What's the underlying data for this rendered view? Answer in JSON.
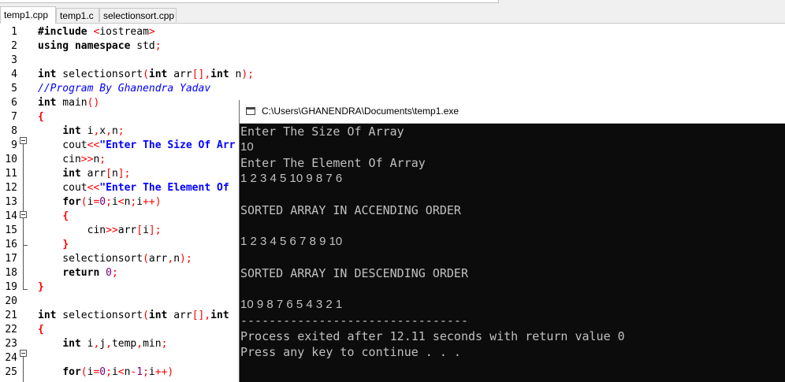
{
  "tabs": [
    "temp1.cpp",
    "temp1.c",
    "selectionsort.cpp"
  ],
  "editor": {
    "line_numbers": [
      "1",
      "2",
      "3",
      "4",
      "5",
      "6",
      "7",
      "8",
      "9",
      "10",
      "11",
      "12",
      "13",
      "14",
      "15",
      "16",
      "17",
      "18",
      "19",
      "20",
      "21",
      "22",
      "23",
      "24",
      "25"
    ],
    "lines": [
      "#include <iostream>",
      "using namespace std;",
      "",
      "int selectionsort(int arr[],int n);",
      "//Program By Ghanendra Yadav",
      "int main()",
      "{",
      "    int i,x,n;",
      "    cout<<\"Enter The Size Of Arr",
      "    cin>>n;",
      "    int arr[n];",
      "    cout<<\"Enter The Element Of ",
      "    for(i=0;i<n;i++)",
      "    {",
      "        cin>>arr[i];",
      "    }",
      "    selectionsort(arr,n);",
      "    return 0;",
      "}",
      "",
      "int selectionsort(int arr[],int ",
      "{",
      "    int i,j,temp,min;",
      "",
      "    for(i=0;i<n-1;i++)"
    ]
  },
  "console": {
    "title": "C:\\Users\\GHANENDRA\\Documents\\temp1.exe",
    "lines": [
      "Enter The Size Of Array",
      "10",
      "Enter The Element Of Array",
      "1 2 3 4 5 10 9 8 7 6",
      "",
      "SORTED ARRAY IN ACCENDING ORDER",
      "",
      "1 2 3 4 5 6 7 8 9 10",
      "",
      "SORTED ARRAY IN DESCENDING ORDER",
      "",
      "10 9 8 7 6 5 4 3 2 1",
      "--------------------------------",
      "Process exited after 12.11 seconds with return value 0",
      "Press any key to continue . . ."
    ]
  },
  "colors": {
    "console_bg": "#0c0c0c",
    "console_text": "#c0c0c0",
    "keyword": "#000000",
    "string": "#0000ff",
    "operator": "#ff0000",
    "number": "#800080",
    "comment": "#0000ff",
    "preprocessor": "#008000"
  }
}
